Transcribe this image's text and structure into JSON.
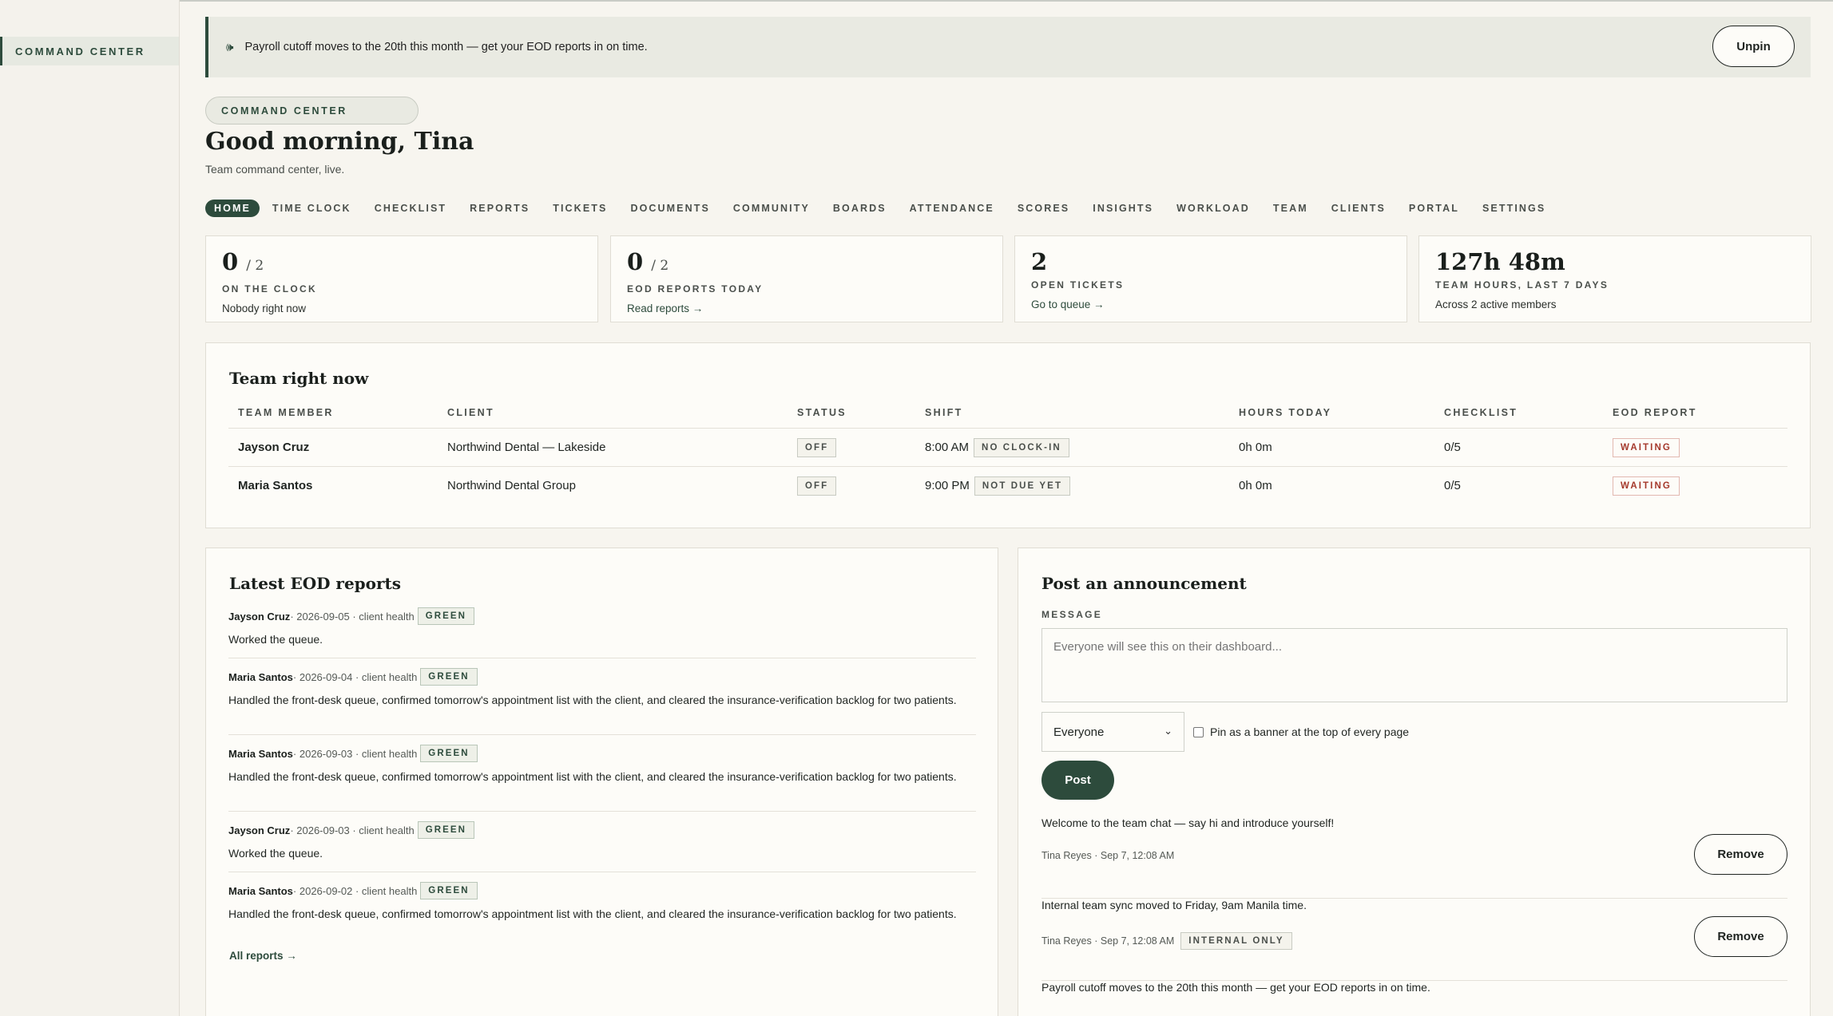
{
  "sidebar": {
    "active_item": "COMMAND CENTER"
  },
  "banner": {
    "icon": "megaphone-icon",
    "text": "Payroll cutoff moves to the 20th this month — get your EOD reports in on time.",
    "unpin_label": "Unpin"
  },
  "header": {
    "eyebrow": "COMMAND CENTER",
    "greeting": "Good morning, Tina",
    "subtitle": "Team command center, live."
  },
  "tabs": [
    "HOME",
    "TIME CLOCK",
    "CHECKLIST",
    "REPORTS",
    "TICKETS",
    "DOCUMENTS",
    "COMMUNITY",
    "BOARDS",
    "ATTENDANCE",
    "SCORES",
    "INSIGHTS",
    "WORKLOAD",
    "TEAM",
    "CLIENTS",
    "PORTAL",
    "SETTINGS"
  ],
  "stats": [
    {
      "value": "0",
      "denominator": "/ 2",
      "label": "ON THE CLOCK",
      "note": "Nobody right now"
    },
    {
      "value": "0",
      "denominator": "/ 2",
      "label": "EOD REPORTS TODAY",
      "link": "Read reports →"
    },
    {
      "value": "2",
      "label": "OPEN TICKETS",
      "link": "Go to queue →"
    },
    {
      "value": "127h 48m",
      "label": "TEAM HOURS, LAST 7 DAYS",
      "note": "Across 2 active members"
    }
  ],
  "team": {
    "title": "Team right now",
    "columns": [
      "TEAM MEMBER",
      "CLIENT",
      "STATUS",
      "SHIFT",
      "HOURS TODAY",
      "CHECKLIST",
      "EOD REPORT"
    ],
    "rows": [
      {
        "member": "Jayson Cruz",
        "client": "Northwind Dental — Lakeside",
        "status": "OFF",
        "shift_time": "8:00 AM",
        "shift_badge": "NO CLOCK-IN",
        "hours": "0h 0m",
        "checklist": "0/5",
        "eod": "WAITING"
      },
      {
        "member": "Maria Santos",
        "client": "Northwind Dental Group",
        "status": "OFF",
        "shift_time": "9:00 PM",
        "shift_badge": "NOT DUE YET",
        "hours": "0h 0m",
        "checklist": "0/5",
        "eod": "WAITING"
      }
    ]
  },
  "eod": {
    "title": "Latest EOD reports",
    "items": [
      {
        "who": "Jayson Cruz",
        "meta": " · 2026-09-05 · client health",
        "badge": "GREEN",
        "body": "Worked the queue."
      },
      {
        "who": "Maria Santos",
        "meta": " · 2026-09-04 · client health",
        "badge": "GREEN",
        "body": "Handled the front-desk queue, confirmed tomorrow's appointment list with the client, and cleared the insurance-verification backlog for two patients."
      },
      {
        "who": "Maria Santos",
        "meta": " · 2026-09-03 · client health",
        "badge": "GREEN",
        "body": "Handled the front-desk queue, confirmed tomorrow's appointment list with the client, and cleared the insurance-verification backlog for two patients."
      },
      {
        "who": "Jayson Cruz",
        "meta": " · 2026-09-03 · client health",
        "badge": "GREEN",
        "body": "Worked the queue."
      },
      {
        "who": "Maria Santos",
        "meta": " · 2026-09-02 · client health",
        "badge": "GREEN",
        "body": "Handled the front-desk queue, confirmed tomorrow's appointment list with the client, and cleared the insurance-verification backlog for two patients."
      }
    ],
    "all_link": "All reports →"
  },
  "announcement": {
    "title": "Post an announcement",
    "message_label": "MESSAGE",
    "message_placeholder": "Everyone will see this on their dashboard...",
    "audience": "Everyone",
    "pin_label": "Pin as a banner at the top of every page",
    "pin_checked": false,
    "post_label": "Post",
    "remove_label": "Remove",
    "items": [
      {
        "text": "Welcome to the team chat — say hi and introduce yourself!",
        "meta": "Tina Reyes · Sep 7, 12:08 AM",
        "badge": ""
      },
      {
        "text": "Internal team sync moved to Friday, 9am Manila time.",
        "meta": "Tina Reyes · Sep 7, 12:08 AM",
        "badge": "INTERNAL ONLY"
      },
      {
        "text": "Payroll cutoff moves to the 20th this month — get your EOD reports in on time.",
        "meta": "",
        "badge": ""
      }
    ]
  },
  "colors": {
    "accent": "#2d4b3c",
    "background": "#f7f5ef",
    "card": "#fdfcf8",
    "warning": "#a5392c"
  }
}
